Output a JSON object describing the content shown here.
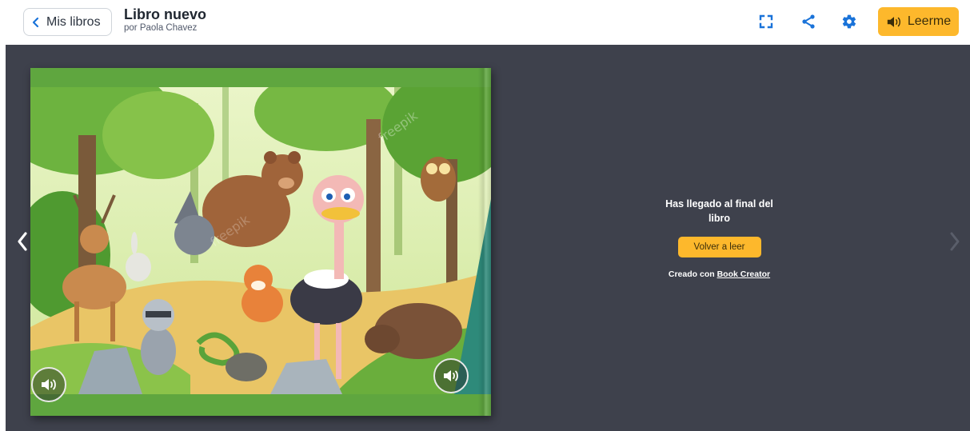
{
  "header": {
    "back_label": "Mis libros",
    "book_title": "Libro nuevo",
    "author": "por Paola Chavez",
    "read_aloud_label": "Leerme"
  },
  "end_panel": {
    "message": "Has llegado al final del libro",
    "reread_label": "Volver a leer",
    "credit_prefix": "Creado con ",
    "credit_link": "Book Creator"
  },
  "page": {
    "watermark": "freepik"
  },
  "colors": {
    "accent": "#fdb82c",
    "icon_blue": "#1a73d9",
    "stage_bg": "#3e414c",
    "page_green": "#5fa63f"
  },
  "icons": {
    "back": "chevron-left-icon",
    "fullscreen": "fullscreen-icon",
    "share": "share-icon",
    "settings": "gear-icon",
    "speaker": "speaker-icon",
    "prev": "chevron-left-icon",
    "next": "chevron-right-icon"
  }
}
